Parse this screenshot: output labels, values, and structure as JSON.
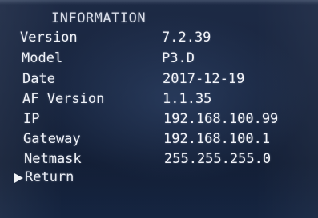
{
  "menu": {
    "title": "INFORMATION",
    "items": [
      {
        "label": "Version",
        "value": "7.2.39"
      },
      {
        "label": "Model",
        "value": "P3.D"
      },
      {
        "label": "Date",
        "value": "2017-12-19"
      },
      {
        "label": "AF Version",
        "value": "1.1.35"
      },
      {
        "label": "IP",
        "value": "192.168.100.99"
      },
      {
        "label": "Gateway",
        "value": "192.168.100.1"
      },
      {
        "label": "Netmask",
        "value": "255.255.255.0"
      }
    ],
    "return_label": "Return",
    "return_icon": "triangle-right-icon"
  }
}
